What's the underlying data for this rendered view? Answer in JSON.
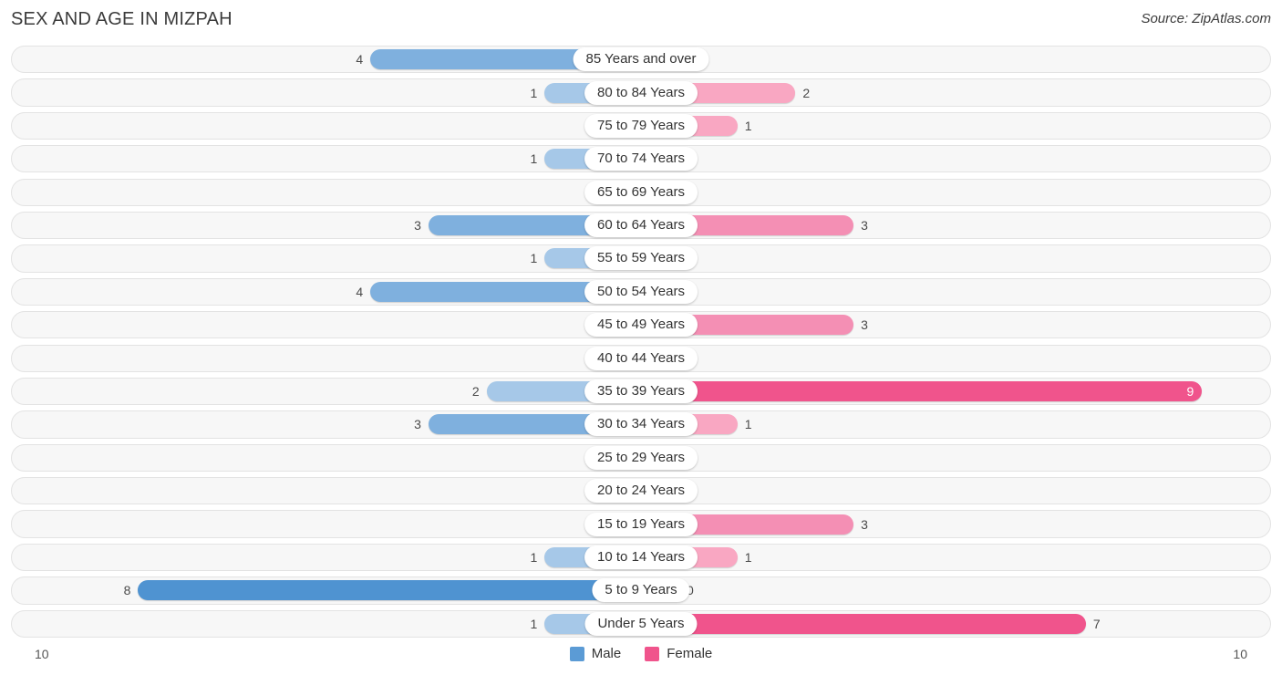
{
  "header": {
    "title": "SEX AND AGE IN MIZPAH",
    "source": "Source: ZipAtlas.com"
  },
  "axis": {
    "left_max_label": "10",
    "right_max_label": "10"
  },
  "legend": {
    "male_label": "Male",
    "female_label": "Female",
    "male_color": "#5b9bd5",
    "female_color": "#f0548c"
  },
  "colors": {
    "male_light": "#a6c8e8",
    "male_mid": "#7fb0de",
    "male_dark": "#4f93d1",
    "female_light": "#f9a7c2",
    "female_mid": "#f48fb4",
    "female_dark": "#f0548c",
    "track_fill": "#f7f7f7",
    "track_border": "#e3e3e3",
    "text": "#4a4a4a"
  },
  "chart_data": {
    "type": "bar",
    "title": "SEX AND AGE IN MIZPAH",
    "subtitle": "",
    "xlabel": "",
    "ylabel": "",
    "orientation": "horizontal",
    "style": "population-pyramid",
    "axis_max": 10,
    "xlim": [
      10,
      10
    ],
    "grid": false,
    "legend_position": "bottom-center",
    "categories": [
      "85 Years and over",
      "80 to 84 Years",
      "75 to 79 Years",
      "70 to 74 Years",
      "65 to 69 Years",
      "60 to 64 Years",
      "55 to 59 Years",
      "50 to 54 Years",
      "45 to 49 Years",
      "40 to 44 Years",
      "35 to 39 Years",
      "30 to 34 Years",
      "25 to 29 Years",
      "20 to 24 Years",
      "15 to 19 Years",
      "10 to 14 Years",
      "5 to 9 Years",
      "Under 5 Years"
    ],
    "series": [
      {
        "name": "Male",
        "color": "#5b9bd5",
        "values": [
          4,
          1,
          0,
          1,
          0,
          3,
          1,
          4,
          0,
          0,
          2,
          3,
          0,
          0,
          0,
          1,
          8,
          1
        ]
      },
      {
        "name": "Female",
        "color": "#f0548c",
        "values": [
          0,
          2,
          1,
          0,
          0,
          3,
          0,
          0,
          3,
          0,
          9,
          1,
          0,
          0,
          3,
          1,
          0,
          7
        ]
      }
    ]
  },
  "rows": [
    {
      "age": "85 Years and over",
      "male": "4",
      "female": "0"
    },
    {
      "age": "80 to 84 Years",
      "male": "1",
      "female": "2"
    },
    {
      "age": "75 to 79 Years",
      "male": "0",
      "female": "1"
    },
    {
      "age": "70 to 74 Years",
      "male": "1",
      "female": "0"
    },
    {
      "age": "65 to 69 Years",
      "male": "0",
      "female": "0"
    },
    {
      "age": "60 to 64 Years",
      "male": "3",
      "female": "3"
    },
    {
      "age": "55 to 59 Years",
      "male": "1",
      "female": "0"
    },
    {
      "age": "50 to 54 Years",
      "male": "4",
      "female": "0"
    },
    {
      "age": "45 to 49 Years",
      "male": "0",
      "female": "3"
    },
    {
      "age": "40 to 44 Years",
      "male": "0",
      "female": "0"
    },
    {
      "age": "35 to 39 Years",
      "male": "2",
      "female": "9"
    },
    {
      "age": "30 to 34 Years",
      "male": "3",
      "female": "1"
    },
    {
      "age": "25 to 29 Years",
      "male": "0",
      "female": "0"
    },
    {
      "age": "20 to 24 Years",
      "male": "0",
      "female": "0"
    },
    {
      "age": "15 to 19 Years",
      "male": "0",
      "female": "3"
    },
    {
      "age": "10 to 14 Years",
      "male": "1",
      "female": "1"
    },
    {
      "age": "5 to 9 Years",
      "male": "8",
      "female": "0"
    },
    {
      "age": "Under 5 Years",
      "male": "1",
      "female": "7"
    }
  ]
}
